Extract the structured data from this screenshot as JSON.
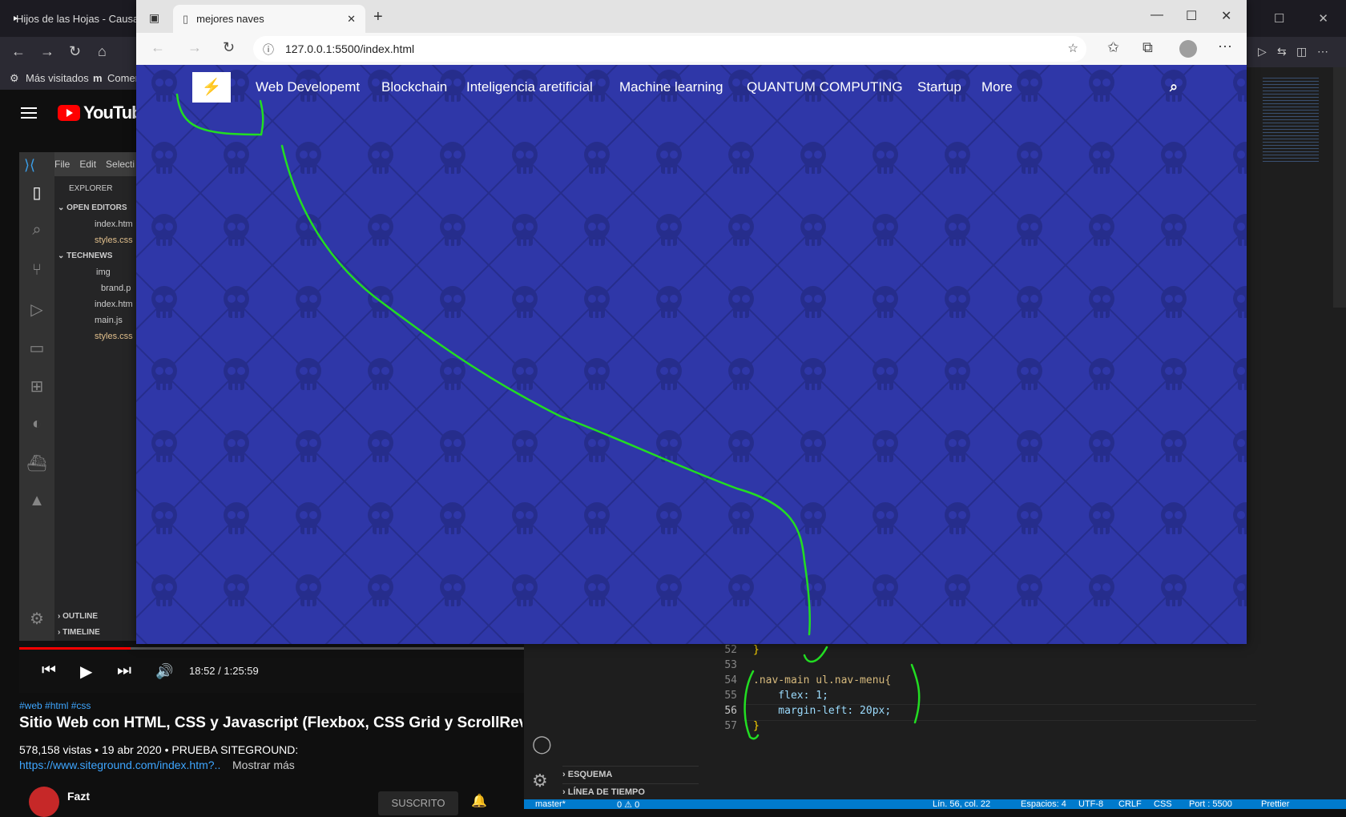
{
  "background_browser": {
    "tab_title": "Hijos de las Hojas - Causa",
    "bookmark": "Más visitados",
    "bookmark2": "Comer"
  },
  "youtube": {
    "logo": "YouTube",
    "time": "18:52 / 1:25:59",
    "progress": 0.22,
    "tags": "#web #html #css",
    "title": "Sitio Web con HTML, CSS y Javascript (Flexbox, CSS Grid y ScrollReveal) | T",
    "views": "578,158 vistas • 19 abr 2020 • PRUEBA SITEGROUND:",
    "link": "https://www.siteground.com/index.htm?..",
    "more": "Mostrar más",
    "channel": "Fazt",
    "subscribe": "SUSCRITO"
  },
  "vscode": {
    "menu": [
      "File",
      "Edit",
      "Selecti"
    ],
    "explorer": "EXPLORER",
    "open_editors": "OPEN EDITORS",
    "open_files": [
      "index.htm",
      "styles.css"
    ],
    "project": "TECHNEWS",
    "tree": [
      "img",
      "brand.p",
      "index.htm",
      "main.js",
      "styles.css"
    ],
    "outline": "OUTLINE",
    "timeline": "TIMELINE",
    "esquema": "ESQUEMA",
    "linea_tiempo": "LÍNEA DE TIEMPO",
    "line_numbers": [
      "52",
      "53",
      "54",
      "55",
      "56",
      "57"
    ],
    "code": [
      "}",
      "",
      ".nav-main ul.nav-menu{",
      "    flex: 1;",
      "    margin-left: 20px;",
      "}"
    ],
    "status_branch": "master*",
    "status_errors": "0 ⚠ 0",
    "status_pos": "Lín. 56, col. 22",
    "status_spaces": "Espacios: 4",
    "status_enc": "UTF-8",
    "status_eol": "CRLF",
    "status_lang": "CSS",
    "status_port": "Port : 5500",
    "status_prettier": "Prettier"
  },
  "edge": {
    "tab_title": "mejores naves",
    "url": "127.0.0.1:5500/index.html",
    "page": {
      "nav_items": [
        "Web Developemt",
        "Blockchain",
        "Inteligencia aretificial",
        "Machine learning",
        "QUANTUM COMPUTING",
        "Startup",
        "More"
      ]
    }
  },
  "colors": {
    "page_bg": "#2f37a8",
    "annotation": "#22dd22"
  }
}
